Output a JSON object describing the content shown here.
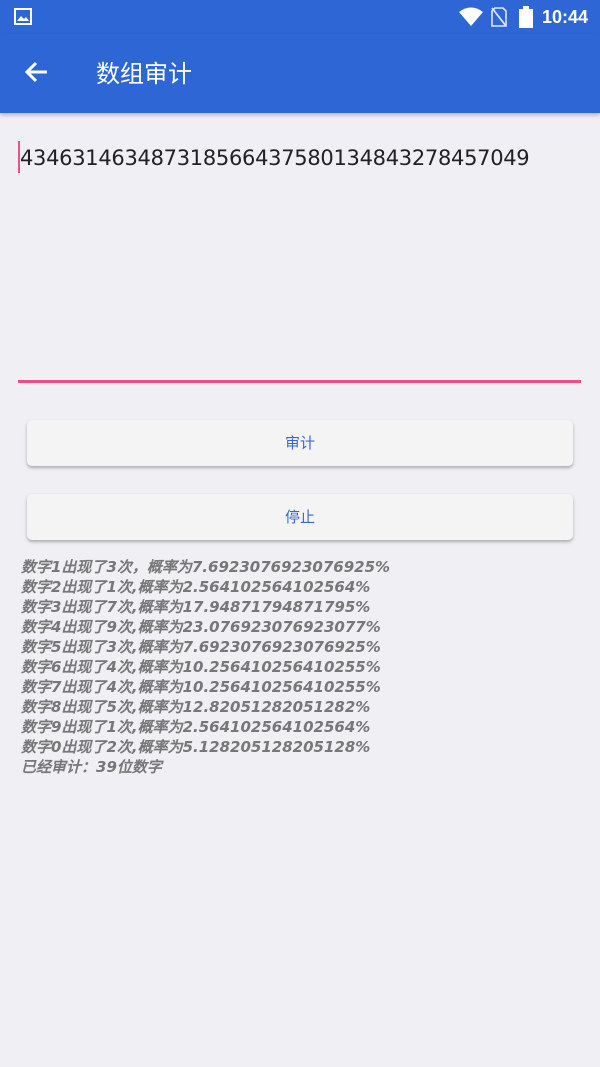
{
  "status_bar": {
    "time": "10:44",
    "icons": [
      "gallery-icon",
      "wifi-icon",
      "no-sim-icon",
      "battery-icon"
    ]
  },
  "app_bar": {
    "title": "数组审计",
    "back_icon": "arrow-left-icon"
  },
  "input": {
    "value": "434631463487318566437580134843278457049"
  },
  "buttons": {
    "audit_label": "审计",
    "stop_label": "停止"
  },
  "results": {
    "lines": [
      "数字1出现了3次，概率为7.6923076923076925%",
      "数字2出现了1次,概率为2.564102564102564%",
      "数字3出现了7次,概率为17.94871794871795%",
      "数字4出现了9次,概率为23.076923076923077%",
      "数字5出现了3次,概率为7.6923076923076925%",
      "数字6出现了4次,概率为10.256410256410255%",
      "数字7出现了4次,概率为10.256410256410255%",
      "数字8出现了5次,概率为12.82051282051282%",
      "数字9出现了1次,概率为2.564102564102564%",
      "数字0出现了2次,概率为5.128205128205128%",
      "已经审计：39位数字"
    ]
  },
  "colors": {
    "primary": "#2f66d6",
    "accent": "#ef4d85",
    "background": "#efeff4",
    "button_text": "#3a67c8"
  }
}
